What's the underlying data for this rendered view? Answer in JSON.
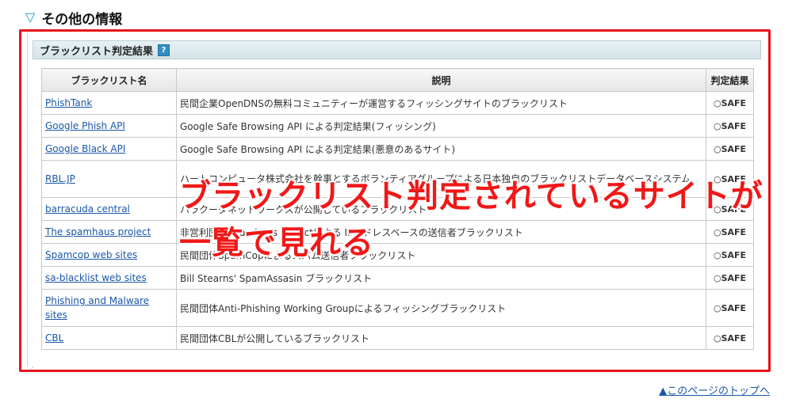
{
  "section": {
    "title": "その他の情報",
    "toggle_icon": "triangle-down-icon",
    "accent": "#1a93c8"
  },
  "panel": {
    "title": "ブラックリスト判定結果",
    "help_label": "?"
  },
  "table": {
    "headers": [
      "ブラックリスト名",
      "説明",
      "判定結果"
    ],
    "rows": [
      {
        "name": "PhishTank",
        "desc": "民間企業OpenDNSの無料コミュニティーが運営するフィッシングサイトのブラックリスト",
        "result": "SAFE"
      },
      {
        "name": "Google Phish API",
        "desc": "Google Safe Browsing API による判定結果(フィッシング)",
        "result": "SAFE"
      },
      {
        "name": "Google Black API",
        "desc": "Google Safe Browsing API による判定結果(悪意のあるサイト)",
        "result": "SAFE"
      },
      {
        "name": "RBL.JP",
        "desc": "ハートコンピュータ株式会社を幹事とするボランティアグループによる日本独自のブラックリストデータベースシステム",
        "result": "SAFE"
      },
      {
        "name": "barracuda central",
        "desc": "バラクーダネットワークスが公開しているブラックリスト",
        "result": "SAFE"
      },
      {
        "name": "The spamhaus project",
        "desc": "非営利団体Spamhaus Projectによる IPアドレスベースの送信者ブラックリスト",
        "result": "SAFE"
      },
      {
        "name": "Spamcop web sites",
        "desc": "民間団体SpamCopによるスパム送信者ブラックリスト",
        "result": "SAFE"
      },
      {
        "name": "sa-blacklist web sites",
        "desc": "Bill Stearns' SpamAssasin ブラックリスト",
        "result": "SAFE"
      },
      {
        "name": "Phishing and Malware sites",
        "desc": "民間団体Anti-Phishing Working Groupによるフィッシングブラックリスト",
        "result": "SAFE"
      },
      {
        "name": "CBL",
        "desc": "民間団体CBLが公開しているブラックリスト",
        "result": "SAFE"
      }
    ]
  },
  "overlay": {
    "line1": "ブラックリスト判定されているサイトが",
    "line2": "一覧で見れる",
    "color": "#f01818"
  },
  "footer": {
    "page_top_link": "▲このページのトップへ"
  }
}
